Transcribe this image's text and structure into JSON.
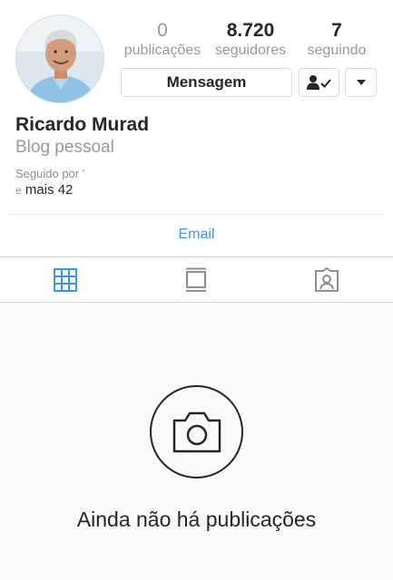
{
  "profile": {
    "name": "Ricardo Murad",
    "category": "Blog pessoal",
    "avatar_icon": "profile-photo"
  },
  "stats": {
    "posts_count": "0",
    "posts_label": "publicações",
    "followers_count": "8.720",
    "followers_label": "seguidores",
    "following_count": "7",
    "following_label": "seguindo"
  },
  "actions": {
    "message_label": "Mensagem",
    "following_icon": "person-check-icon",
    "more_icon": "chevron-down-icon"
  },
  "followed_by": {
    "prefix": "Seguido por '",
    "more_prefix": "e",
    "more_text": "mais 42"
  },
  "contact": {
    "email_label": "Email"
  },
  "tabs": [
    {
      "name": "grid",
      "icon": "grid-icon",
      "active": true
    },
    {
      "name": "feed",
      "icon": "feed-icon",
      "active": false
    },
    {
      "name": "tagged",
      "icon": "tagged-icon",
      "active": false
    }
  ],
  "empty_state": {
    "icon": "camera-icon",
    "text": "Ainda não há publicações"
  },
  "colors": {
    "accent": "#3897f0",
    "text": "#262626",
    "secondary": "#999999",
    "border": "#dbdbdb"
  }
}
